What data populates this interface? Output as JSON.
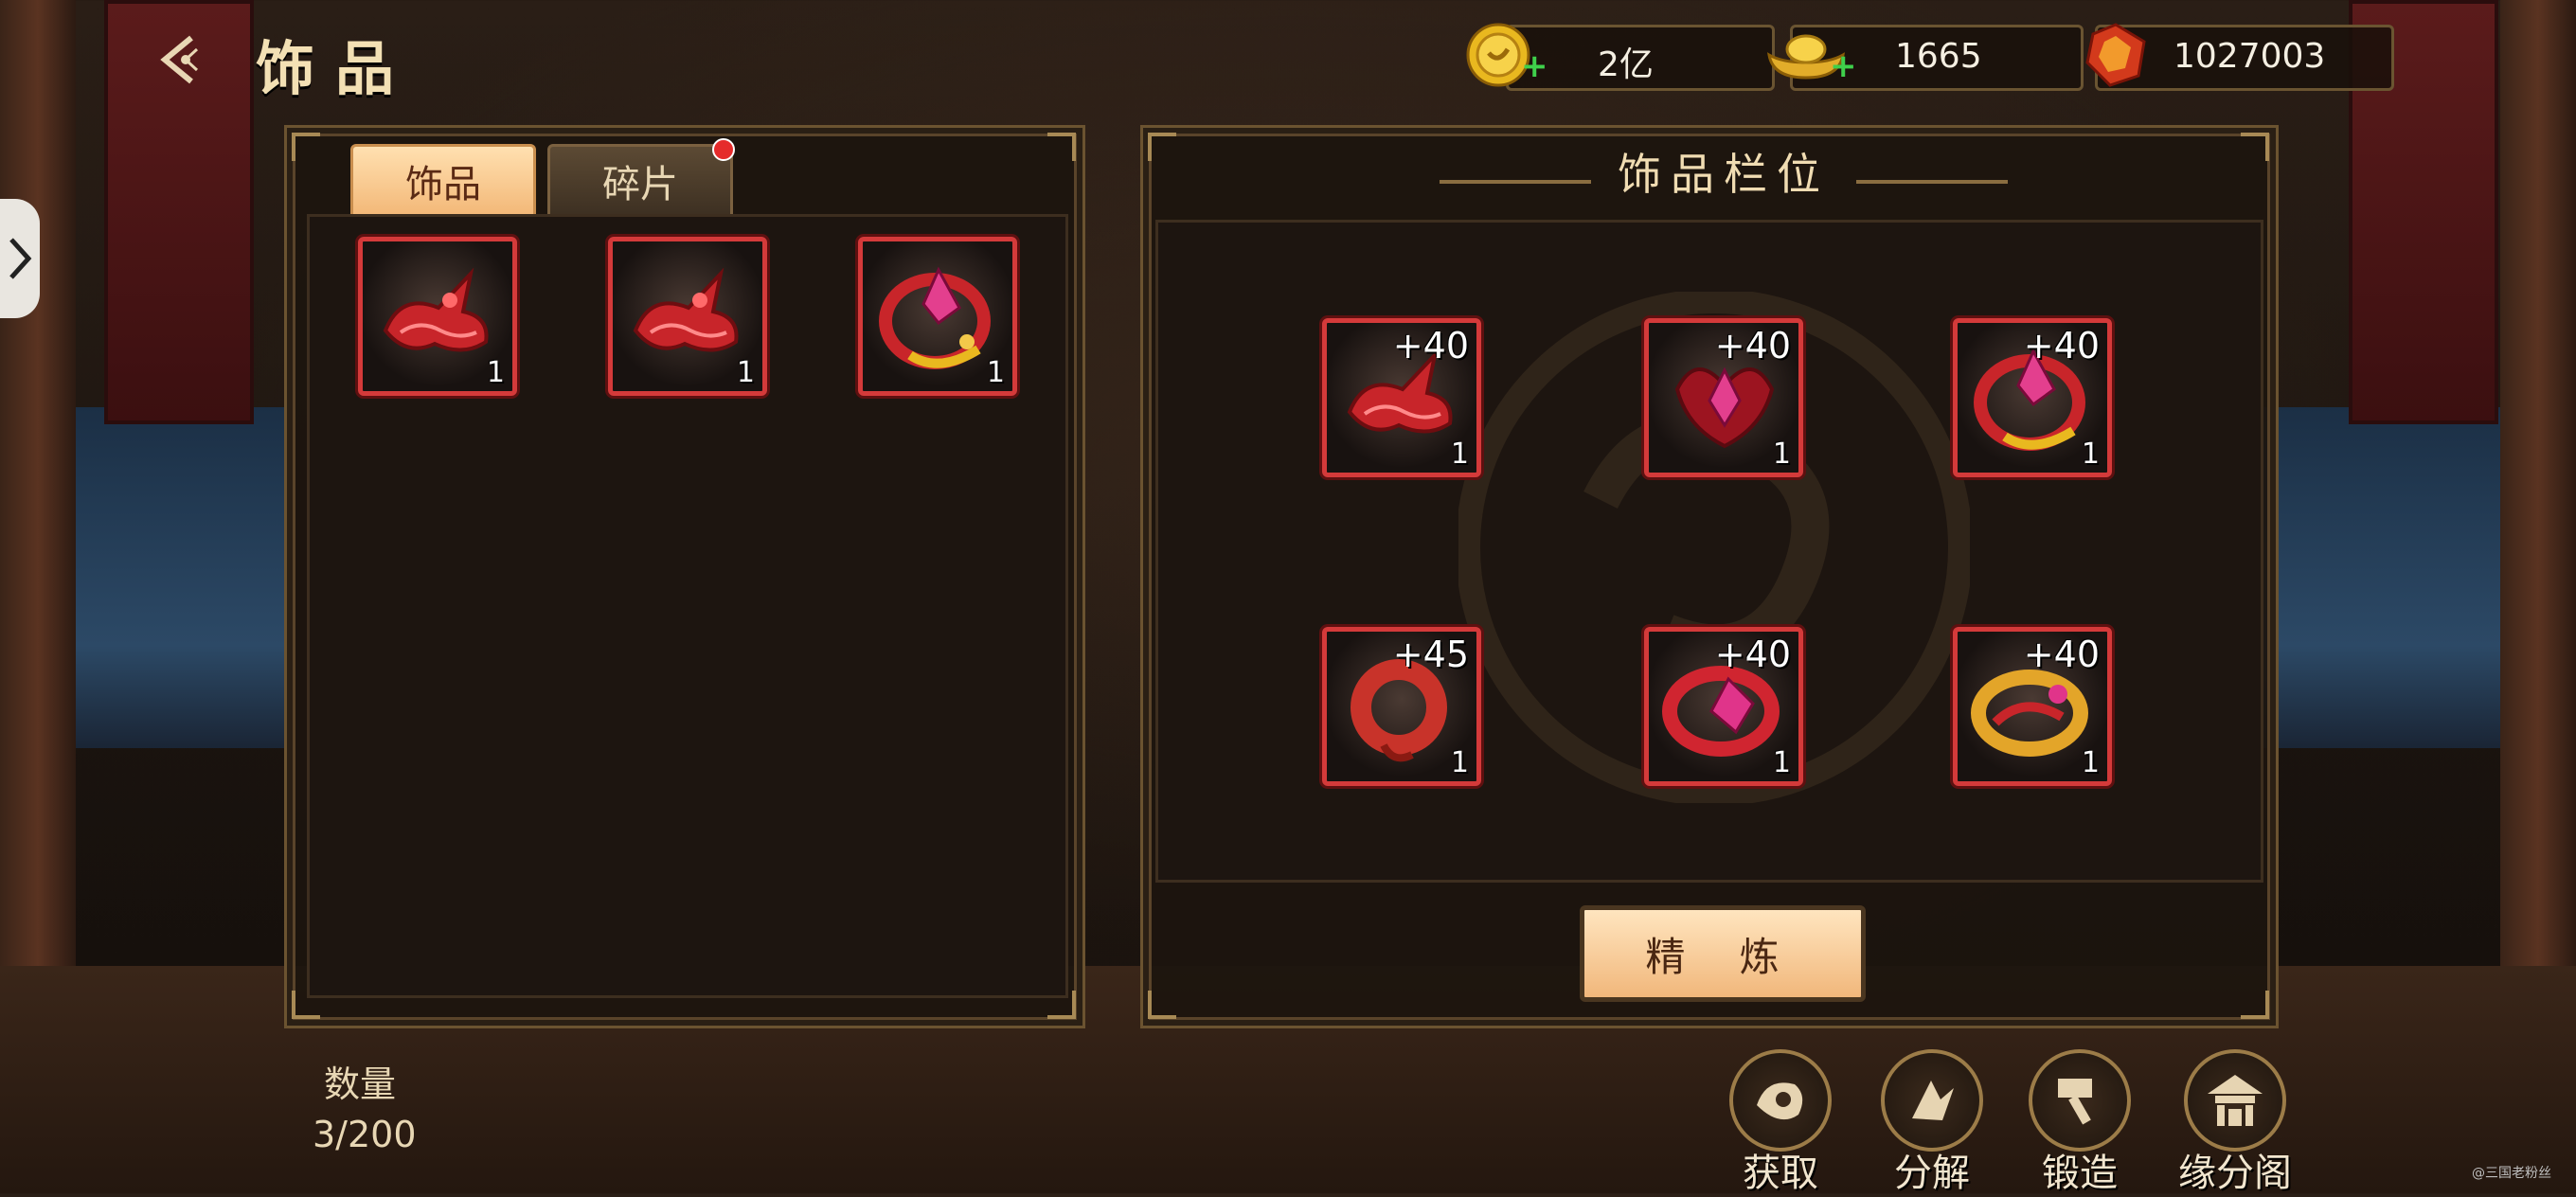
{
  "header": {
    "title": "饰品"
  },
  "currencies": [
    {
      "icon": "gold-coin-icon",
      "value": "2亿",
      "has_plus": true
    },
    {
      "icon": "gold-ingot-icon",
      "value": "1665",
      "has_plus": true
    },
    {
      "icon": "red-gem-icon",
      "value": "1027003",
      "has_plus": false
    }
  ],
  "inventory": {
    "tabs": [
      {
        "label": "饰品",
        "active": true
      },
      {
        "label": "碎片",
        "active": false,
        "notification": true
      }
    ],
    "items": [
      {
        "icon": "red-hairpin-icon",
        "count": "1"
      },
      {
        "icon": "red-hairpin-icon",
        "count": "1"
      },
      {
        "icon": "gold-crown-ring-icon",
        "count": "1"
      }
    ],
    "quantity_label": "数量",
    "quantity_value": "3/200"
  },
  "slots": {
    "title": "饰品栏位",
    "items": [
      {
        "icon": "red-hairpin-icon",
        "level": "+40",
        "count": "1"
      },
      {
        "icon": "red-pendant-icon",
        "level": "+40",
        "count": "1"
      },
      {
        "icon": "gold-crown-ring-icon",
        "level": "+40",
        "count": "1"
      },
      {
        "icon": "red-bracelet-icon",
        "level": "+45",
        "count": "1"
      },
      {
        "icon": "gem-ring-icon",
        "level": "+40",
        "count": "1"
      },
      {
        "icon": "gold-ring-icon",
        "level": "+40",
        "count": "1"
      }
    ],
    "refine_label": "精 炼"
  },
  "bottom_actions": [
    {
      "icon": "obtain-icon",
      "label": "获取"
    },
    {
      "icon": "decompose-icon",
      "label": "分解"
    },
    {
      "icon": "hammer-icon",
      "label": "锻造"
    },
    {
      "icon": "pavilion-icon",
      "label": "缘分阁"
    }
  ],
  "watermark": "@三国老粉丝",
  "colors": {
    "accent": "#f3b878",
    "item_border": "#d43a3a",
    "panel_border": "#6b5330"
  }
}
